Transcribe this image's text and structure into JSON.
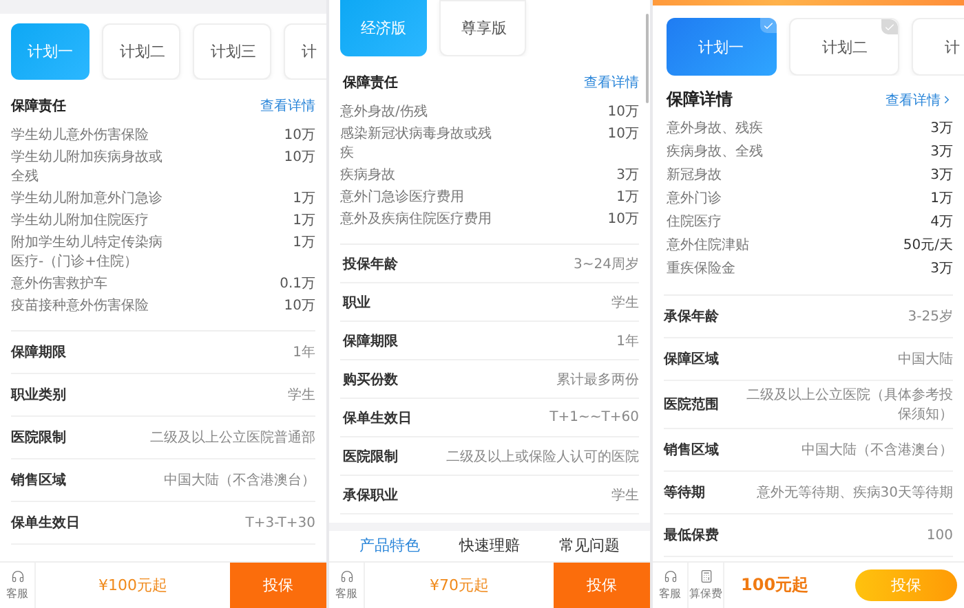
{
  "panels": [
    {
      "kind": "classic",
      "plans": [
        {
          "label": "计划一",
          "selected": true
        },
        {
          "label": "计划二",
          "selected": false
        },
        {
          "label": "计划三",
          "selected": false
        },
        {
          "label": "计",
          "selected": false
        }
      ],
      "coverage": {
        "title": "保障责任",
        "link": "查看详情",
        "items": [
          {
            "name": "学生幼儿意外伤害保险",
            "amount": "10万"
          },
          {
            "name": "学生幼儿附加疾病身故或全残",
            "amount": "10万"
          },
          {
            "name": "学生幼儿附加意外门急诊",
            "amount": "1万"
          },
          {
            "name": "学生幼儿附加住院医疗",
            "amount": "1万"
          },
          {
            "name": "附加学生幼儿特定传染病医疗-（门诊+住院）",
            "amount": "1万"
          },
          {
            "name": "意外伤害救护车",
            "amount": "0.1万"
          },
          {
            "name": "疫苗接种意外伤害保险",
            "amount": "10万"
          }
        ]
      },
      "details": [
        {
          "label": "保障期限",
          "value": "1年"
        },
        {
          "label": "职业类别",
          "value": "学生"
        },
        {
          "label": "医院限制",
          "value": "二级及以上公立医院普通部"
        },
        {
          "label": "销售区域",
          "value": "中国大陆（不含港澳台）"
        },
        {
          "label": "保单生效日",
          "value": "T+3-T+30"
        }
      ],
      "footer": {
        "tools": [
          {
            "kind": "support",
            "label": "客服"
          }
        ],
        "price": "¥100元起",
        "cta": "投保"
      }
    },
    {
      "kind": "plain",
      "plans": [
        {
          "label": "经济版",
          "selected": true
        },
        {
          "label": "尊享版",
          "selected": false
        }
      ],
      "coverage": {
        "title": "保障责任",
        "link": "查看详情",
        "items": [
          {
            "name": "意外身故/伤残",
            "amount": "10万"
          },
          {
            "name": "感染新冠状病毒身故或残疾",
            "amount": "10万"
          },
          {
            "name": "疾病身故",
            "amount": "3万"
          },
          {
            "name": "意外门急诊医疗费用",
            "amount": "1万"
          },
          {
            "name": "意外及疾病住院医疗费用",
            "amount": "10万"
          }
        ]
      },
      "details": [
        {
          "label": "投保年龄",
          "value": "3~24周岁"
        },
        {
          "label": "职业",
          "value": "学生"
        },
        {
          "label": "保障期限",
          "value": "1年"
        },
        {
          "label": "购买份数",
          "value": "累计最多两份"
        },
        {
          "label": "保单生效日",
          "value": "T+1~~T+60"
        },
        {
          "label": "医院限制",
          "value": "二级及以上或保险人认可的医院"
        },
        {
          "label": "承保职业",
          "value": "学生"
        }
      ],
      "section_tabs": [
        {
          "label": "产品特色",
          "selected": true
        },
        {
          "label": "快速理赔",
          "selected": false
        },
        {
          "label": "常见问题",
          "selected": false
        }
      ],
      "footer": {
        "tools": [
          {
            "kind": "support",
            "label": "客服"
          }
        ],
        "price": "¥70元起",
        "cta": "投保"
      }
    },
    {
      "kind": "modern",
      "plans": [
        {
          "label": "计划一",
          "selected": true
        },
        {
          "label": "计划二",
          "selected": false
        },
        {
          "label": "计",
          "selected": false
        }
      ],
      "coverage": {
        "title": "保障详情",
        "link": "查看详情",
        "items": [
          {
            "name": "意外身故、残疾",
            "amount": "3万"
          },
          {
            "name": "疾病身故、全残",
            "amount": "3万"
          },
          {
            "name": "新冠身故",
            "amount": "3万"
          },
          {
            "name": "意外门诊",
            "amount": "1万"
          },
          {
            "name": "住院医疗",
            "amount": "4万"
          },
          {
            "name": "意外住院津贴",
            "amount": "50元/天"
          },
          {
            "name": "重疾保险金",
            "amount": "3万"
          }
        ]
      },
      "details": [
        {
          "label": "承保年龄",
          "value": "3-25岁"
        },
        {
          "label": "保障区域",
          "value": "中国大陆"
        },
        {
          "label": "医院范围",
          "value": "二级及以上公立医院（具体参考投保须知）"
        },
        {
          "label": "销售区域",
          "value": "中国大陆（不含港澳台）"
        },
        {
          "label": "等待期",
          "value": "意外无等待期、疾病30天等待期"
        },
        {
          "label": "最低保费",
          "value": "100"
        }
      ],
      "footer": {
        "tools": [
          {
            "kind": "support",
            "label": "客服"
          },
          {
            "kind": "calculator",
            "label": "算保费"
          }
        ],
        "price": "100元起",
        "cta": "投保"
      }
    }
  ]
}
